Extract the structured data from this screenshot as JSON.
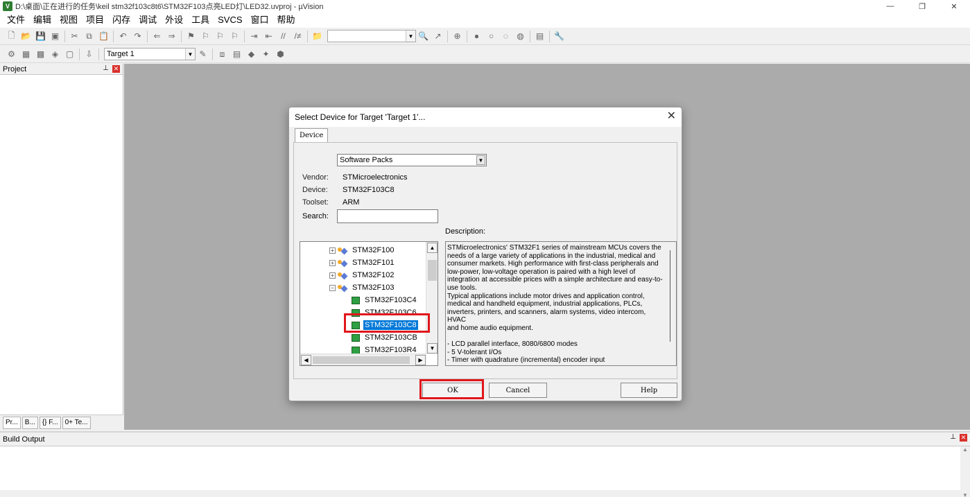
{
  "titlebar": {
    "icon": "uvision-icon",
    "title": "D:\\桌面\\正在进行的任务\\keil stm32f103c8t6\\STM32F103点亮LED灯\\LED32.uvproj - µVision",
    "minimize": "—",
    "restore": "❐",
    "close": "✕"
  },
  "menu": [
    "文件",
    "编辑",
    "视图",
    "项目",
    "闪存",
    "调试",
    "外设",
    "工具",
    "SVCS",
    "窗口",
    "帮助"
  ],
  "toolbar2": {
    "target": "Target 1"
  },
  "project_panel": {
    "title": "Project",
    "tabs": [
      "Pr...",
      "B...",
      "{} F...",
      "0+ Te..."
    ]
  },
  "build_output": {
    "title": "Build Output"
  },
  "dialog": {
    "title": "Select Device for Target 'Target 1'...",
    "tab": "Device",
    "pack_select": "Software Packs",
    "vendor_label": "Vendor:",
    "vendor": "STMicroelectronics",
    "device_label": "Device:",
    "device": "STM32F103C8",
    "toolset_label": "Toolset:",
    "toolset": "ARM",
    "search_label": "Search:",
    "search_value": "",
    "description_label": "Description:",
    "tree": [
      {
        "label": "STM32F100",
        "type": "group",
        "expander": "+"
      },
      {
        "label": "STM32F101",
        "type": "group",
        "expander": "+"
      },
      {
        "label": "STM32F102",
        "type": "group",
        "expander": "+"
      },
      {
        "label": "STM32F103",
        "type": "group",
        "expander": "−"
      },
      {
        "label": "STM32F103C4",
        "type": "device"
      },
      {
        "label": "STM32F103C6",
        "type": "device"
      },
      {
        "label": "STM32F103C8",
        "type": "device",
        "selected": true
      },
      {
        "label": "STM32F103CB",
        "type": "device"
      },
      {
        "label": "STM32F103R4",
        "type": "device"
      }
    ],
    "description": "STMicroelectronics' STM32F1 series of mainstream MCUs covers the\nneeds of a large variety of applications in the industrial, medical and\nconsumer markets. High performance with first-class peripherals and\nlow-power, low-voltage operation is paired with a high level of\nintegration at accessible prices with a simple architecture and easy-to-\nuse tools.\nTypical applications include motor drives and application control,\nmedical and handheld equipment, industrial applications, PLCs,\ninverters, printers, and scanners, alarm systems, video intercom, HVAC\nand home audio equipment.\n\n - LCD parallel interface, 8080/6800 modes\n - 5 V-tolerant I/Os\n - Timer with quadrature (incremental) encoder input",
    "buttons": {
      "ok": "OK",
      "cancel": "Cancel",
      "help": "Help"
    }
  },
  "colors": {
    "highlight": "#e0161b",
    "selection": "#0078d7",
    "workspace": "#ababab"
  }
}
